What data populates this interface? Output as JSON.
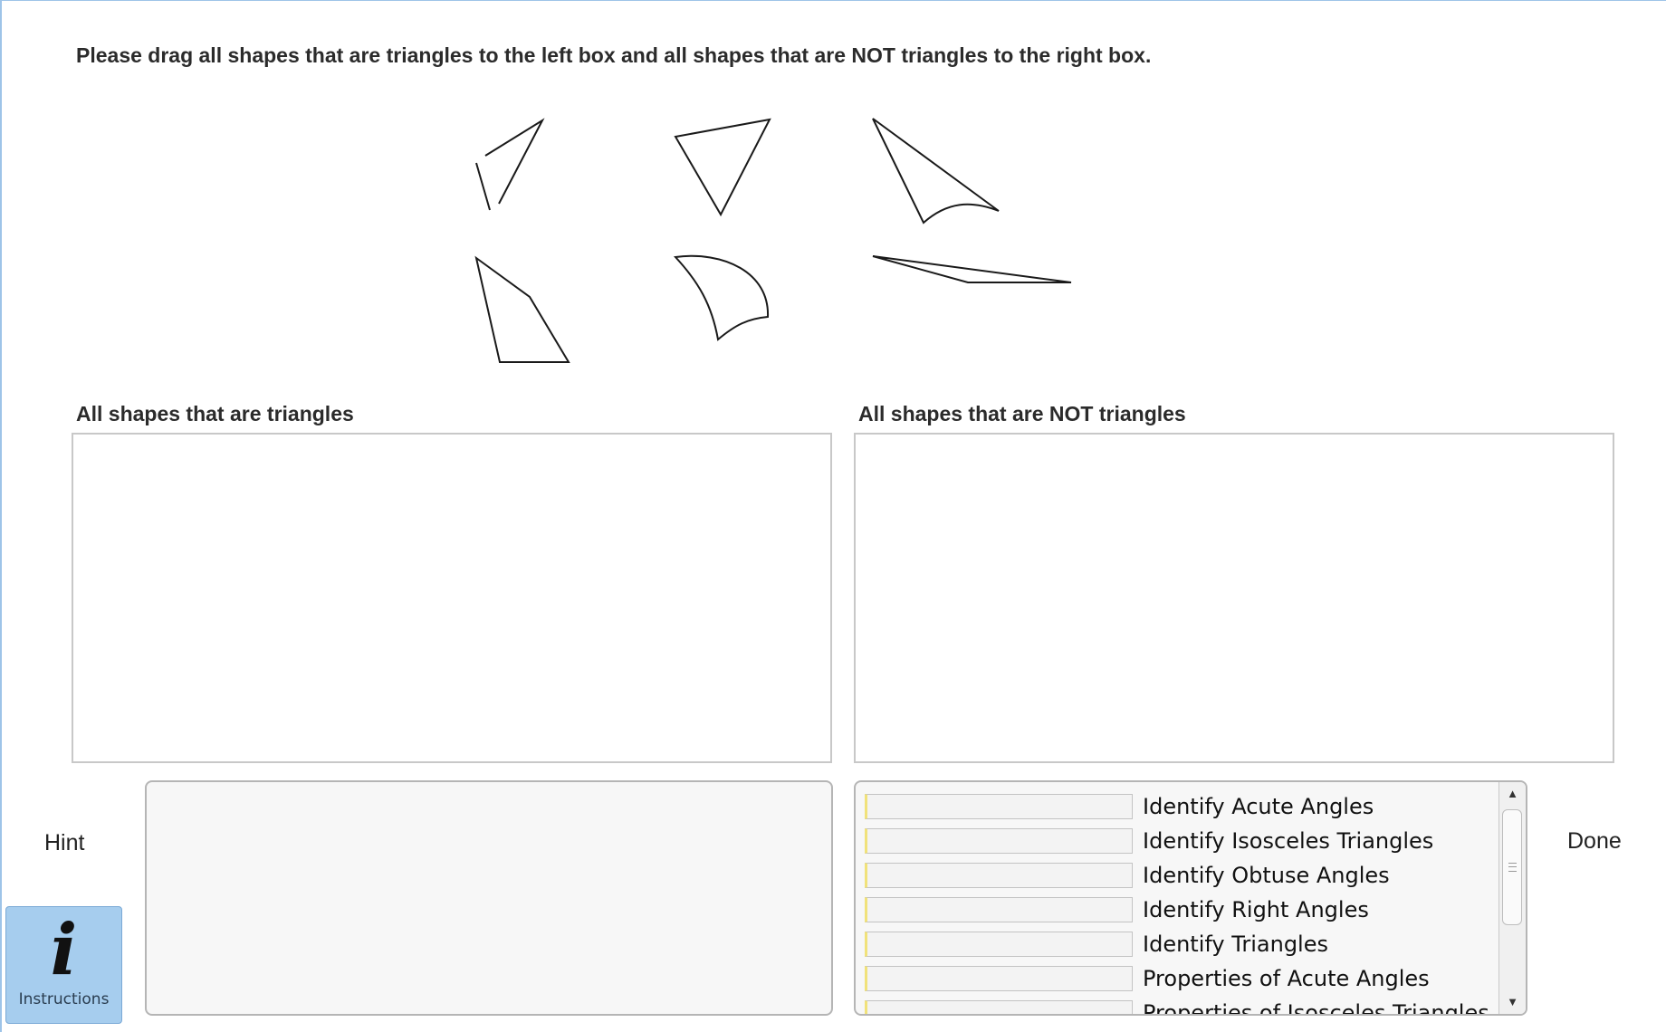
{
  "instruction": "Please drag all shapes that are triangles to the left box and all shapes that are NOT triangles to the right box.",
  "boxes": {
    "triangles_label": "All shapes that are triangles",
    "not_triangles_label": "All shapes that are NOT triangles"
  },
  "hint": {
    "label": "Hint",
    "text": ""
  },
  "skills": {
    "items": [
      "Identify Acute Angles",
      "Identify Isosceles Triangles",
      "Identify Obtuse Angles",
      "Identify Right Angles",
      "Identify Triangles",
      "Properties of Acute Angles",
      "Properties of Isosceles Triangles"
    ]
  },
  "done_label": "Done",
  "instructions_button": {
    "icon": "info-icon",
    "glyph": "i",
    "label": "Instructions"
  },
  "scrollbar": {
    "up": "▲",
    "down": "▼"
  },
  "colors": {
    "instructions_bg": "#a6cdee",
    "skill_bar_accent": "#f1e27a"
  }
}
